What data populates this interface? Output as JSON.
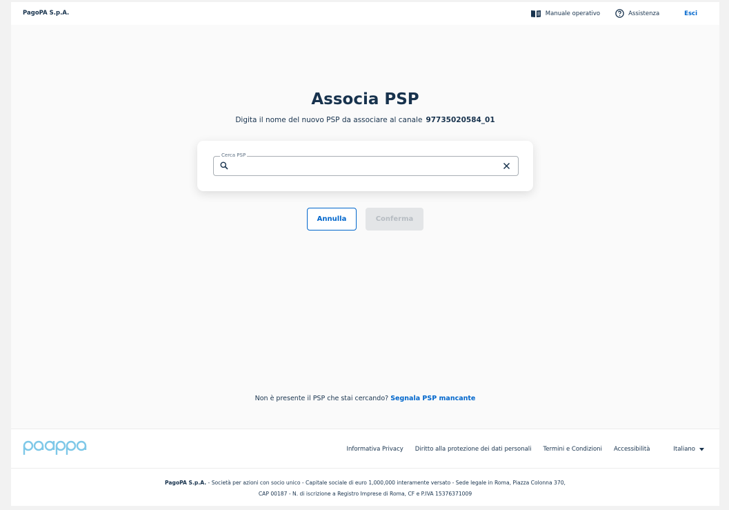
{
  "header": {
    "brand": "PagoPA S.p.A.",
    "manual_label": "Manuale operativo",
    "help_label": "Assistenza",
    "logout_label": "Esci"
  },
  "main": {
    "title": "Associa PSP",
    "subtitle_text": "Digita il nome del nuovo PSP da associare al canale",
    "channel_code": "97735020584_01",
    "search": {
      "legend": "Cerca PSP",
      "value": "",
      "placeholder": ""
    },
    "cancel_label": "Annulla",
    "confirm_label": "Conferma",
    "missing_text": "Non è presente il PSP che stai cercando?",
    "missing_link": "Segnala PSP mancante"
  },
  "footer": {
    "logo_text": "pagopa",
    "links": [
      "Informativa Privacy",
      "Diritto alla protezione dei dati personali",
      "Termini e Condizioni",
      "Accessibilità"
    ],
    "language": "Italiano",
    "legal_company": "PagoPA S.p.A.",
    "legal_line1": " - Società per azioni con socio unico - Capitale sociale di euro 1,000,000 interamente versato - Sede legale in Roma, Piazza Colonna 370,",
    "legal_line2": "CAP 00187 - N. di iscrizione a Registro Imprese di Roma, CF e P.IVA 15376371009"
  },
  "colors": {
    "primary": "#0066cc",
    "text": "#17324d",
    "disabled_bg": "#e3e5e7",
    "logo": "#7ec8e8"
  }
}
